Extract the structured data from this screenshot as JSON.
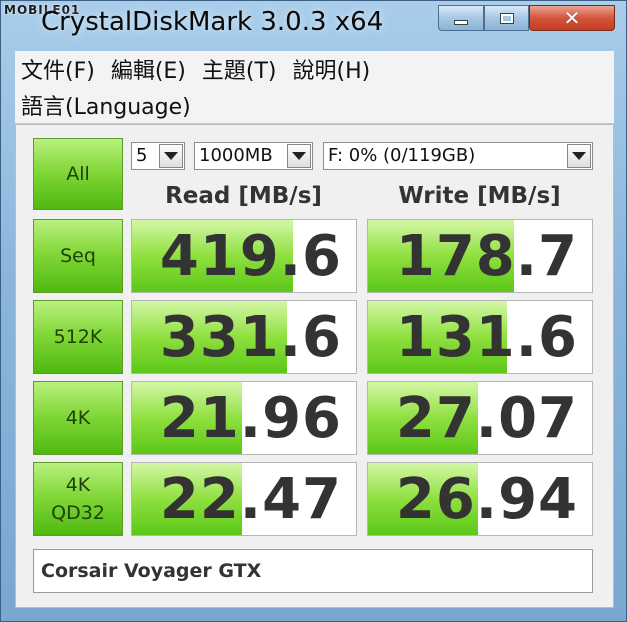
{
  "watermark": "MOBILE01",
  "window": {
    "title": "CrystalDiskMark 3.0.3 x64",
    "close_glyph": "✕"
  },
  "menu": {
    "row1": [
      "文件(F)",
      "編輯(E)",
      "主題(T)",
      "說明(H)"
    ],
    "row2": [
      "語言(Language)"
    ]
  },
  "controls": {
    "all_label": "All",
    "count": "5",
    "size": "1000MB",
    "drive": "F: 0% (0/119GB)"
  },
  "headers": {
    "read": "Read [MB/s]",
    "write": "Write [MB/s]"
  },
  "tests": [
    {
      "label_lines": [
        "Seq"
      ],
      "read": "419.6",
      "write": "178.7"
    },
    {
      "label_lines": [
        "512K"
      ],
      "read": "331.6",
      "write": "131.6"
    },
    {
      "label_lines": [
        "4K"
      ],
      "read": "21.96",
      "write": "27.07"
    },
    {
      "label_lines": [
        "4K",
        "QD32"
      ],
      "read": "22.47",
      "write": "26.94"
    }
  ],
  "comment": "Corsair Voyager GTX",
  "colors": {
    "accent_green": "#5cc717",
    "title_bar_blue": "#8ab6dc",
    "close_red": "#c23d22"
  },
  "icons": [
    "chevron-down-icon",
    "minimize-icon",
    "maximize-icon",
    "close-icon"
  ]
}
